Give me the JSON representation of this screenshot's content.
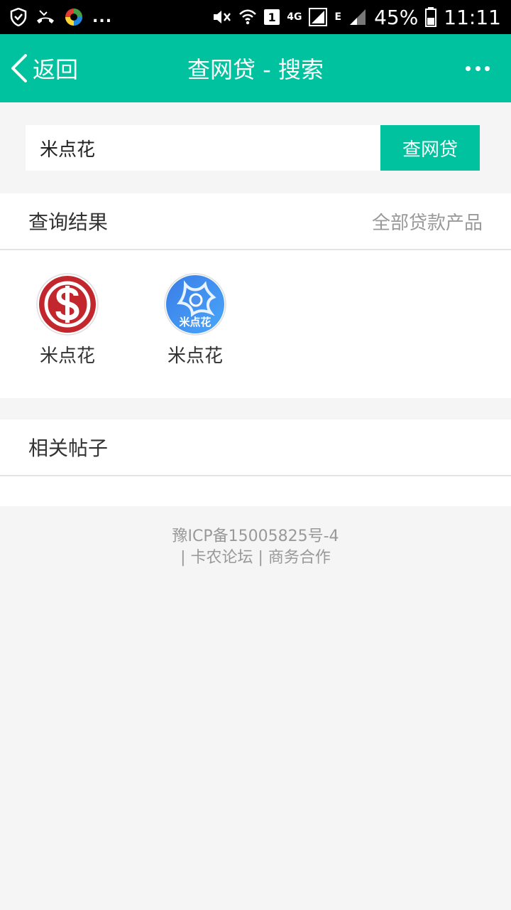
{
  "status_bar": {
    "icons_left": [
      "shield-icon",
      "missed-call-icon",
      "app-color-icon"
    ],
    "more_dots": "...",
    "icons_right": [
      "mute-icon",
      "wifi-icon",
      "sim-icon",
      "network-icon",
      "signal-icon",
      "battery-icon"
    ],
    "sim_number": "1",
    "network_label": "4G",
    "edge_label": "E",
    "battery": "45%",
    "time": "11:11"
  },
  "header": {
    "back_label": "返回",
    "title": "查网贷 - 搜索"
  },
  "search": {
    "value": "米点花",
    "button_label": "查网贷"
  },
  "results": {
    "title": "查询结果",
    "all_link": "全部贷款产品",
    "items": [
      {
        "name": "米点花",
        "logo": "dollar-logo-icon",
        "color": "#c1272d"
      },
      {
        "name": "米点花",
        "logo": "midianhua-logo-icon",
        "logo_text": "米点花",
        "color": "#3a8ef0"
      }
    ]
  },
  "posts": {
    "title": "相关帖子"
  },
  "footer": {
    "icp": "豫ICP备15005825号-4",
    "sep": "|",
    "link1": "卡农论坛",
    "link2": "商务合作"
  },
  "colors": {
    "accent": "#00c29f",
    "background": "#f5f5f5"
  }
}
